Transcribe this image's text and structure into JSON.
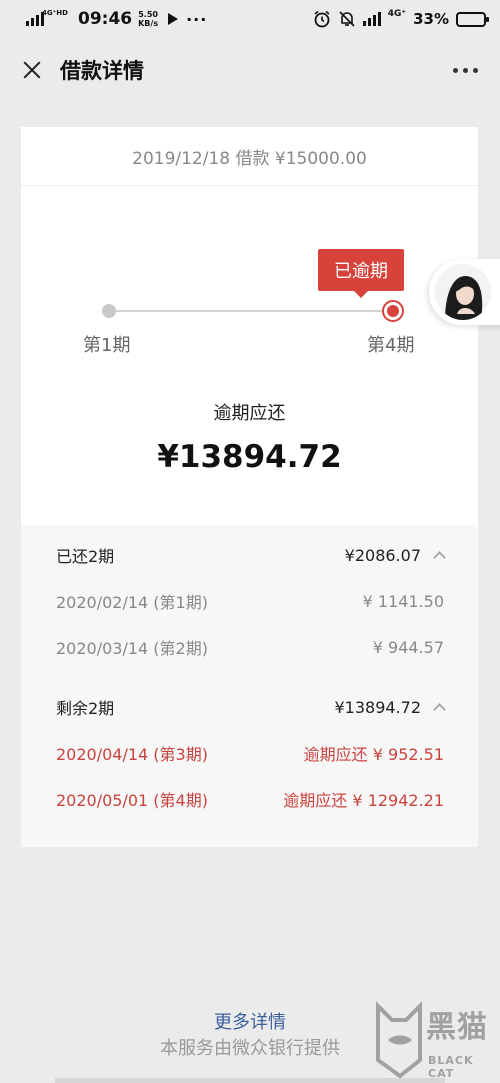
{
  "status_bar": {
    "network_small": "4G⁺HD",
    "time": "09:46",
    "speed_value": "5.50",
    "speed_unit": "KB/s",
    "network_right": "4G⁺",
    "battery_percent": "33%",
    "battery_level": 0.33
  },
  "nav": {
    "title": "借款详情"
  },
  "loan": {
    "header": "2019/12/18 借款 ¥15000.00",
    "status_badge": "已逾期",
    "start_label": "第1期",
    "end_label": "第4期",
    "due_label": "逾期应还",
    "due_amount": "¥13894.72"
  },
  "paid": {
    "title": "已还2期",
    "total": "¥2086.07",
    "items": [
      {
        "label": "2020/02/14 (第1期)",
        "amount": "¥ 1141.50"
      },
      {
        "label": "2020/03/14 (第2期)",
        "amount": "¥ 944.57"
      }
    ]
  },
  "remaining": {
    "title": "剩余2期",
    "total": "¥13894.72",
    "items": [
      {
        "label": "2020/04/14 (第3期)",
        "amount": "逾期应还 ¥ 952.51"
      },
      {
        "label": "2020/05/01 (第4期)",
        "amount": "逾期应还 ¥ 12942.21"
      }
    ]
  },
  "footer": {
    "more_link": "更多详情",
    "provider": "本服务由微众银行提供"
  },
  "watermark": {
    "text": "黑猫",
    "sub": "BLACK CAT"
  },
  "colors": {
    "overdue_red": "#d7423a",
    "link_blue": "#3b5f9e",
    "background": "#ebebeb"
  }
}
